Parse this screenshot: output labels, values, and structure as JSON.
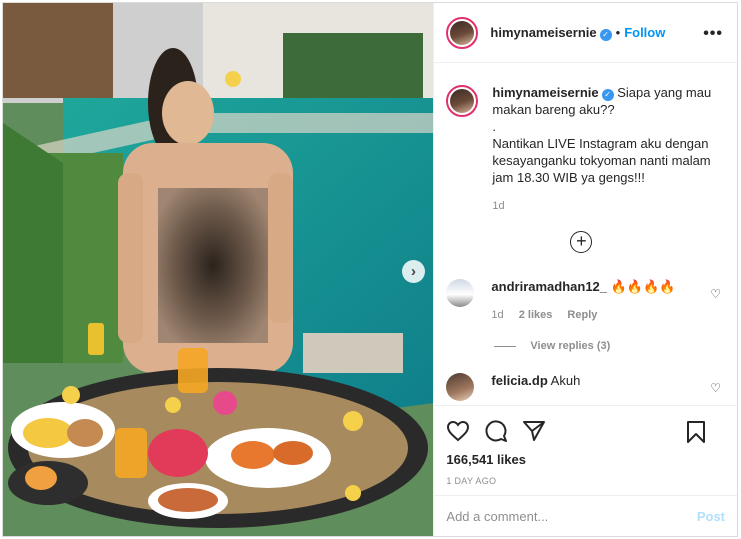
{
  "post": {
    "username": "himynameisernie",
    "follow_label": "Follow",
    "more_label": "•••",
    "dot": "•"
  },
  "caption": {
    "username": "himynameisernie",
    "line1": "Siapa yang mau makan bareng aku??",
    "line2": ".",
    "line3": "Nantikan LIVE Instagram aku dengan kesayanganku tokyoman nanti malam jam 18.30 WIB ya gengs!!!",
    "time": "1d"
  },
  "comments": [
    {
      "username": "andriramadhan12_",
      "text": "🔥🔥🔥🔥",
      "time": "1d",
      "likes": "2 likes",
      "reply": "Reply"
    },
    {
      "username": "felicia.dp",
      "text": "Akuh"
    }
  ],
  "view_replies": "View replies (3)",
  "likes": "166,541 likes",
  "post_time": "1 DAY AGO",
  "add_comment": {
    "placeholder": "Add a comment...",
    "post_label": "Post"
  },
  "colors": {
    "accent": "#0095f6",
    "verified": "#3897f0",
    "post_disabled": "#b2dffc"
  },
  "icons": [
    "verified-badge-icon",
    "more-options-icon",
    "plus-circle-icon",
    "heart-icon",
    "comment-icon",
    "share-icon",
    "bookmark-icon",
    "next-arrow-icon"
  ]
}
